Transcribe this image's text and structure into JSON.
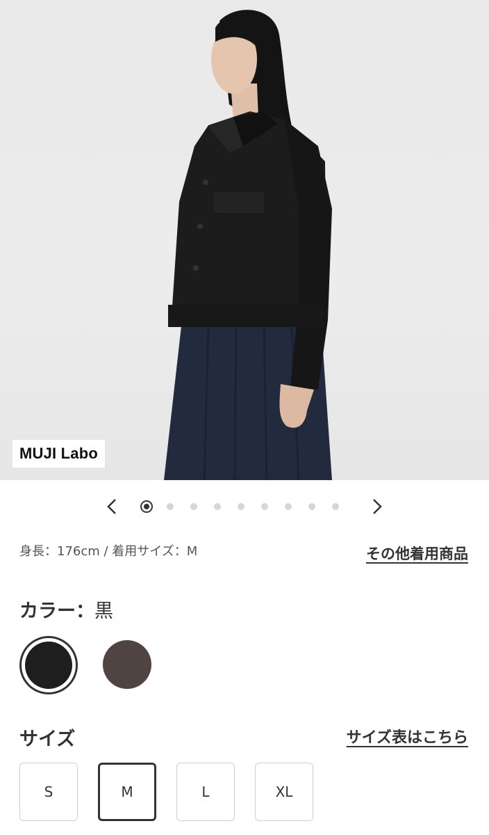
{
  "hero": {
    "image_alt": "woman wearing black cropped jacket and navy skirt",
    "brand_badge": "MUJI Labo"
  },
  "carousel": {
    "prev_icon": "chevron-left-icon",
    "next_icon": "chevron-right-icon",
    "total_images": 9,
    "active_index": 1
  },
  "model_info": "身長：176cm / 着用サイズ：M",
  "other_items_link": "その他着用商品",
  "color": {
    "label": "カラー：",
    "selected_name": "黒",
    "swatches": [
      {
        "name": "黒",
        "hex": "#1e1e1e",
        "selected": true
      },
      {
        "name": "ブラウン",
        "hex": "#4f4441",
        "selected": false
      }
    ]
  },
  "size": {
    "label": "サイズ",
    "chart_link": "サイズ表はこちら",
    "options": [
      "S",
      "M",
      "L",
      "XL"
    ],
    "selected": "M"
  }
}
